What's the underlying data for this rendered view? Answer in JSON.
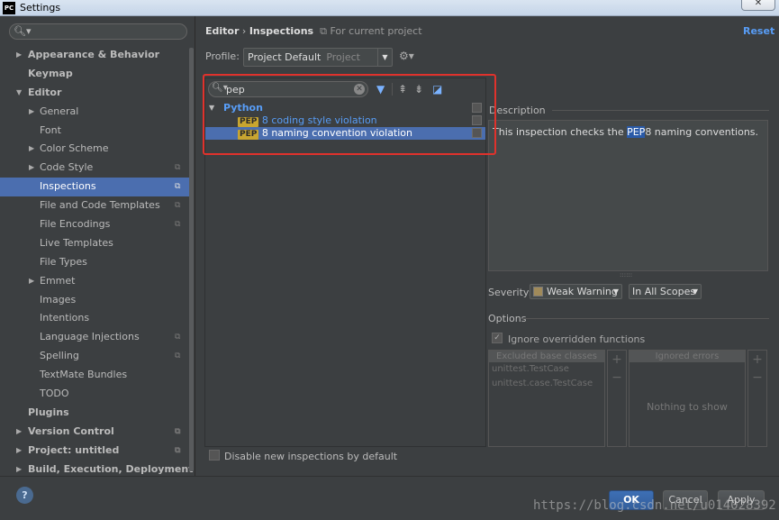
{
  "window": {
    "title": "Settings",
    "app_icon": "PC",
    "close_glyph": "✕"
  },
  "sidebar": {
    "search_value": "",
    "items": [
      {
        "label": "Appearance & Behavior",
        "level": 0,
        "arrow": "right",
        "bold": true
      },
      {
        "label": "Keymap",
        "level": 0,
        "arrow": "",
        "bold": true
      },
      {
        "label": "Editor",
        "level": 0,
        "arrow": "down",
        "bold": true
      },
      {
        "label": "General",
        "level": 1,
        "arrow": "right"
      },
      {
        "label": "Font",
        "level": 1,
        "arrow": ""
      },
      {
        "label": "Color Scheme",
        "level": 1,
        "arrow": "right"
      },
      {
        "label": "Code Style",
        "level": 1,
        "arrow": "right",
        "copy": true
      },
      {
        "label": "Inspections",
        "level": 1,
        "arrow": "",
        "copy": true,
        "selected": true
      },
      {
        "label": "File and Code Templates",
        "level": 1,
        "arrow": "",
        "copy": true
      },
      {
        "label": "File Encodings",
        "level": 1,
        "arrow": "",
        "copy": true
      },
      {
        "label": "Live Templates",
        "level": 1,
        "arrow": ""
      },
      {
        "label": "File Types",
        "level": 1,
        "arrow": ""
      },
      {
        "label": "Emmet",
        "level": 1,
        "arrow": "right"
      },
      {
        "label": "Images",
        "level": 1,
        "arrow": ""
      },
      {
        "label": "Intentions",
        "level": 1,
        "arrow": ""
      },
      {
        "label": "Language Injections",
        "level": 1,
        "arrow": "",
        "copy": true
      },
      {
        "label": "Spelling",
        "level": 1,
        "arrow": "",
        "copy": true
      },
      {
        "label": "TextMate Bundles",
        "level": 1,
        "arrow": ""
      },
      {
        "label": "TODO",
        "level": 1,
        "arrow": ""
      },
      {
        "label": "Plugins",
        "level": 0,
        "arrow": "",
        "bold": true
      },
      {
        "label": "Version Control",
        "level": 0,
        "arrow": "right",
        "bold": true,
        "copy": true
      },
      {
        "label": "Project: untitled",
        "level": 0,
        "arrow": "right",
        "bold": true,
        "copy": true
      },
      {
        "label": "Build, Execution, Deployment",
        "level": 0,
        "arrow": "right",
        "bold": true
      }
    ]
  },
  "header": {
    "crumb_parent": "Editor",
    "crumb_sep": "›",
    "crumb_current": "Inspections",
    "scope_note": "For current project",
    "reset_label": "Reset"
  },
  "profile": {
    "label": "Profile:",
    "value": "Project Default",
    "sub": "Project"
  },
  "inspections": {
    "filter_value": "pep",
    "group": "Python",
    "rows": [
      {
        "badge": "PEP",
        "text": "8 coding style violation",
        "selected": false
      },
      {
        "badge": "PEP",
        "text": "8 naming convention violation",
        "selected": true
      }
    ]
  },
  "description": {
    "label": "Description",
    "text_before": "This inspection checks the ",
    "text_highlight": "PEP",
    "text_after": "8 naming conventions."
  },
  "severity": {
    "label": "Severity:",
    "value": "Weak Warning",
    "swatch_color": "#a08a5a",
    "scope_value": "In All Scopes"
  },
  "options": {
    "label": "Options",
    "ignore_label": "Ignore overridden functions",
    "excluded_header": "Excluded base classes",
    "excluded_items": [
      "unittest.TestCase",
      "unittest.case.TestCase"
    ],
    "ignored_header": "Ignored errors",
    "ignored_empty": "Nothing to show"
  },
  "disable_new_label": "Disable new inspections by default",
  "footer": {
    "help": "?",
    "ok": "OK",
    "cancel": "Cancel",
    "apply": "Apply",
    "watermark": "https://blog.csdn.net/u014028392"
  },
  "colors": {
    "selection": "#4b6eaf",
    "link": "#589df6",
    "highlight_box": "#e0322c"
  }
}
